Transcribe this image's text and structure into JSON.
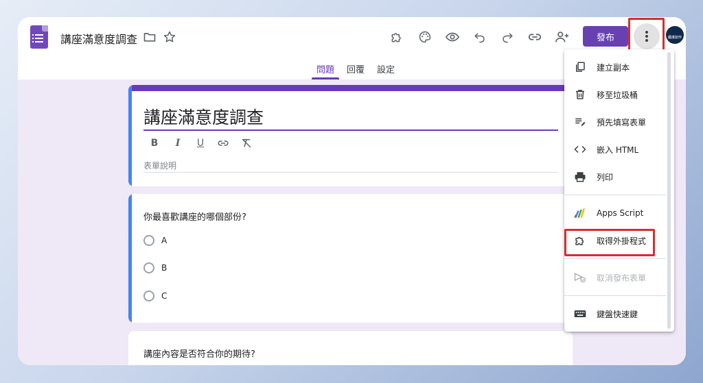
{
  "header": {
    "doc_title": "講座滿意度調查",
    "publish_label": "發布",
    "avatar_text": "醬爆創作"
  },
  "tabs": [
    {
      "label": "問題",
      "active": true
    },
    {
      "label": "回覆",
      "active": false
    },
    {
      "label": "設定",
      "active": false
    }
  ],
  "form": {
    "title": "講座滿意度調查",
    "description_placeholder": "表單說明",
    "questions": [
      {
        "text": "你最喜歡講座的哪個部份?",
        "options": [
          "A",
          "B",
          "C"
        ]
      },
      {
        "text": "講座內容是否符合你的期待?"
      }
    ]
  },
  "menu": {
    "items": [
      {
        "label": "建立副本",
        "icon": "copy-icon"
      },
      {
        "label": "移至垃圾桶",
        "icon": "trash-icon"
      },
      {
        "label": "預先填寫表單",
        "icon": "prefill-icon"
      },
      {
        "label": "嵌入 HTML",
        "icon": "code-icon"
      },
      {
        "label": "列印",
        "icon": "print-icon"
      },
      {
        "label": "Apps Script",
        "icon": "apps-script-icon"
      },
      {
        "label": "取得外掛程式",
        "icon": "puzzle-icon"
      },
      {
        "label": "取消發布表單",
        "icon": "unpublish-icon",
        "disabled": true
      },
      {
        "label": "鍵盤快速鍵",
        "icon": "keyboard-icon"
      }
    ]
  },
  "colors": {
    "accent": "#673ab7",
    "highlight": "#d32f2f",
    "left_stripe": "#4285f4"
  }
}
